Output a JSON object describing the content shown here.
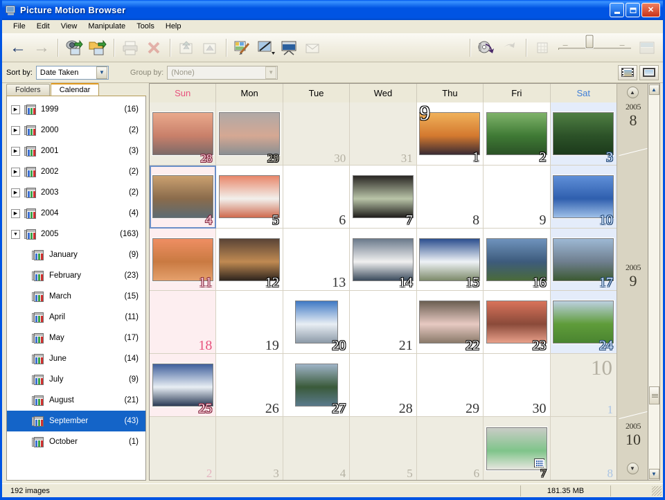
{
  "window": {
    "title": "Picture Motion Browser",
    "icon": "monitor-icon",
    "minimize_label": "",
    "maximize_label": "",
    "close_label": "✕"
  },
  "menu": [
    {
      "label": "File"
    },
    {
      "label": "Edit"
    },
    {
      "label": "View"
    },
    {
      "label": "Manipulate"
    },
    {
      "label": "Tools"
    },
    {
      "label": "Help"
    }
  ],
  "toolbar": {
    "back": "←",
    "forward": "→",
    "import_icon": "import-from-camera-icon",
    "import_folder_icon": "import-from-folder-icon",
    "print_icon": "print-icon",
    "delete_icon": "delete-icon",
    "export1_icon": "export-icon",
    "export2_icon": "export-alt-icon",
    "edit_icon": "edit-image-icon",
    "adjust_icon": "adjust-image-icon",
    "slideshow_icon": "slideshow-icon",
    "mail_icon": "send-mail-icon",
    "burn_icon": "burn-disc-icon",
    "share_icon": "share-icon",
    "zoom_small_icon": "zoom-small-icon",
    "zoom_large_icon": "zoom-large-icon"
  },
  "sortbar": {
    "sort_label": "Sort by:",
    "sort_value": "Date Taken",
    "group_label": "Group by:",
    "group_value": "(None)",
    "view_filmstrip_icon": "filmstrip-view-icon",
    "view_single_icon": "single-view-icon"
  },
  "sidebar": {
    "tabs": [
      {
        "label": "Folders",
        "active": false
      },
      {
        "label": "Calendar",
        "active": true
      }
    ],
    "nodes": [
      {
        "label": "1999",
        "count": "(16)",
        "expanded": false,
        "level": 0,
        "selected": false
      },
      {
        "label": "2000",
        "count": "(2)",
        "expanded": false,
        "level": 0,
        "selected": false
      },
      {
        "label": "2001",
        "count": "(3)",
        "expanded": false,
        "level": 0,
        "selected": false
      },
      {
        "label": "2002",
        "count": "(2)",
        "expanded": false,
        "level": 0,
        "selected": false
      },
      {
        "label": "2003",
        "count": "(2)",
        "expanded": false,
        "level": 0,
        "selected": false
      },
      {
        "label": "2004",
        "count": "(4)",
        "expanded": false,
        "level": 0,
        "selected": false
      },
      {
        "label": "2005",
        "count": "(163)",
        "expanded": true,
        "level": 0,
        "selected": false
      },
      {
        "label": "January",
        "count": "(9)",
        "level": 1,
        "selected": false
      },
      {
        "label": "February",
        "count": "(23)",
        "level": 1,
        "selected": false
      },
      {
        "label": "March",
        "count": "(15)",
        "level": 1,
        "selected": false
      },
      {
        "label": "April",
        "count": "(11)",
        "level": 1,
        "selected": false
      },
      {
        "label": "May",
        "count": "(17)",
        "level": 1,
        "selected": false
      },
      {
        "label": "June",
        "count": "(14)",
        "level": 1,
        "selected": false
      },
      {
        "label": "July",
        "count": "(9)",
        "level": 1,
        "selected": false
      },
      {
        "label": "August",
        "count": "(21)",
        "level": 1,
        "selected": false
      },
      {
        "label": "September",
        "count": "(43)",
        "level": 1,
        "selected": true
      },
      {
        "label": "October",
        "count": "(1)",
        "level": 1,
        "selected": false
      }
    ]
  },
  "calendar": {
    "day_headers": [
      "Sun",
      "Mon",
      "Tue",
      "Wed",
      "Thu",
      "Fri",
      "Sat"
    ],
    "weeks": [
      [
        {
          "day": "28",
          "other": true,
          "thumb": true,
          "colors": [
            "#e9a98c",
            "#c9806a",
            "#7d6a68"
          ],
          "month_mark": null
        },
        {
          "day": "29",
          "other": true,
          "thumb": true,
          "colors": [
            "#b0a9a6",
            "#d5a893",
            "#8a8f92"
          ],
          "month_mark": null
        },
        {
          "day": "30",
          "other": true,
          "thumb": false,
          "colors": [],
          "month_mark": null
        },
        {
          "day": "31",
          "other": true,
          "thumb": false,
          "colors": [],
          "month_mark": null
        },
        {
          "day": "1",
          "other": false,
          "thumb": true,
          "colors": [
            "#f0b15a",
            "#d4792f",
            "#3a2b33"
          ],
          "month_mark": "9"
        },
        {
          "day": "2",
          "other": false,
          "thumb": true,
          "colors": [
            "#7fb36a",
            "#3f7a35",
            "#2b5226"
          ],
          "month_mark": null
        },
        {
          "day": "3",
          "other": false,
          "thumb": true,
          "colors": [
            "#4f7f43",
            "#2c5228",
            "#1c3a1b"
          ],
          "month_mark": null
        }
      ],
      [
        {
          "day": "4",
          "other": false,
          "thumb": true,
          "colors": [
            "#caa070",
            "#8a6b4b",
            "#5d6b72"
          ],
          "month_mark": null,
          "selected": true
        },
        {
          "day": "5",
          "other": false,
          "thumb": true,
          "colors": [
            "#e8876a",
            "#f2f0ec",
            "#cf6a4e"
          ],
          "month_mark": null
        },
        {
          "day": "6",
          "other": false,
          "thumb": false,
          "colors": [],
          "month_mark": null
        },
        {
          "day": "7",
          "other": false,
          "thumb": true,
          "colors": [
            "#2a2724",
            "#b9c4a8",
            "#1f1d1b"
          ],
          "month_mark": null
        },
        {
          "day": "8",
          "other": false,
          "thumb": false,
          "colors": [],
          "month_mark": null
        },
        {
          "day": "9",
          "other": false,
          "thumb": false,
          "colors": [],
          "month_mark": null
        },
        {
          "day": "10",
          "other": false,
          "thumb": true,
          "colors": [
            "#5f8fd8",
            "#2f5fae",
            "#9fc0e8"
          ],
          "month_mark": null
        }
      ],
      [
        {
          "day": "11",
          "other": false,
          "thumb": true,
          "colors": [
            "#ef8e63",
            "#c97a42",
            "#e5a06c"
          ],
          "month_mark": null
        },
        {
          "day": "12",
          "other": false,
          "thumb": true,
          "colors": [
            "#5a4436",
            "#c08a52",
            "#2e241d"
          ],
          "month_mark": null
        },
        {
          "day": "13",
          "other": false,
          "thumb": false,
          "colors": [],
          "month_mark": null
        },
        {
          "day": "14",
          "other": false,
          "thumb": true,
          "colors": [
            "#6b7a8c",
            "#f0f0f0",
            "#3a4a5c"
          ],
          "month_mark": null
        },
        {
          "day": "15",
          "other": false,
          "thumb": true,
          "colors": [
            "#2c4f8f",
            "#eef2f6",
            "#7d8a6a"
          ],
          "month_mark": null
        },
        {
          "day": "16",
          "other": false,
          "thumb": true,
          "colors": [
            "#6f93bd",
            "#3d5b7c",
            "#4a6a3a"
          ],
          "month_mark": null
        },
        {
          "day": "17",
          "other": false,
          "thumb": true,
          "colors": [
            "#9db8d4",
            "#6f7f8f",
            "#3c5a32"
          ],
          "month_mark": null
        }
      ],
      [
        {
          "day": "18",
          "other": false,
          "thumb": false,
          "colors": [],
          "month_mark": null
        },
        {
          "day": "19",
          "other": false,
          "thumb": false,
          "colors": [],
          "month_mark": null
        },
        {
          "day": "20",
          "other": false,
          "thumb": true,
          "portrait": true,
          "colors": [
            "#3f79c4",
            "#e8eef4",
            "#8c9aa8"
          ],
          "month_mark": null
        },
        {
          "day": "21",
          "other": false,
          "thumb": false,
          "colors": [],
          "month_mark": null
        },
        {
          "day": "22",
          "other": false,
          "thumb": true,
          "colors": [
            "#6b5f52",
            "#e7c9c2",
            "#8a7a6a"
          ],
          "month_mark": null
        },
        {
          "day": "23",
          "other": false,
          "thumb": true,
          "colors": [
            "#d9735a",
            "#8a4a3a",
            "#e9a08a"
          ],
          "month_mark": null
        },
        {
          "day": "24",
          "other": false,
          "thumb": true,
          "colors": [
            "#bcd0e0",
            "#5f9c3a",
            "#4a8430"
          ],
          "month_mark": null
        }
      ],
      [
        {
          "day": "25",
          "other": false,
          "thumb": true,
          "colors": [
            "#3f5f9c",
            "#e8eef4",
            "#2a3a55"
          ],
          "month_mark": null
        },
        {
          "day": "26",
          "other": false,
          "thumb": false,
          "colors": [],
          "month_mark": null
        },
        {
          "day": "27",
          "other": false,
          "thumb": true,
          "portrait": true,
          "colors": [
            "#9fb4c8",
            "#3a5a3a",
            "#5a7a8c"
          ],
          "month_mark": null
        },
        {
          "day": "28",
          "other": false,
          "thumb": false,
          "colors": [],
          "month_mark": null
        },
        {
          "day": "29",
          "other": false,
          "thumb": false,
          "colors": [],
          "month_mark": null
        },
        {
          "day": "30",
          "other": false,
          "thumb": false,
          "colors": [],
          "month_mark": null
        },
        {
          "day": "1",
          "other": true,
          "thumb": false,
          "colors": [],
          "month_mark": "10"
        }
      ],
      [
        {
          "day": "2",
          "other": true,
          "thumb": false,
          "colors": [],
          "month_mark": null
        },
        {
          "day": "3",
          "other": true,
          "thumb": false,
          "colors": [],
          "month_mark": null
        },
        {
          "day": "4",
          "other": true,
          "thumb": false,
          "colors": [],
          "month_mark": null
        },
        {
          "day": "5",
          "other": true,
          "thumb": false,
          "colors": [],
          "month_mark": null
        },
        {
          "day": "6",
          "other": true,
          "thumb": false,
          "colors": [],
          "month_mark": null
        },
        {
          "day": "7",
          "other": true,
          "thumb": true,
          "video": true,
          "colors": [
            "#c9ccc6",
            "#7fc48a",
            "#e8e6e0"
          ],
          "month_mark": null
        },
        {
          "day": "8",
          "other": true,
          "thumb": false,
          "colors": [],
          "month_mark": null
        }
      ]
    ],
    "rail": {
      "up_arrow": "▲",
      "down_arrow": "▼",
      "segments": [
        {
          "year": "2005",
          "month": "8"
        },
        {
          "year": "2005",
          "month": "9"
        },
        {
          "year": "2005",
          "month": "10"
        }
      ]
    },
    "scrollbar": {
      "up": "▲",
      "down": "▼"
    }
  },
  "statusbar": {
    "image_count": "192 images",
    "total_size": "181.35 MB",
    "extra": ""
  }
}
